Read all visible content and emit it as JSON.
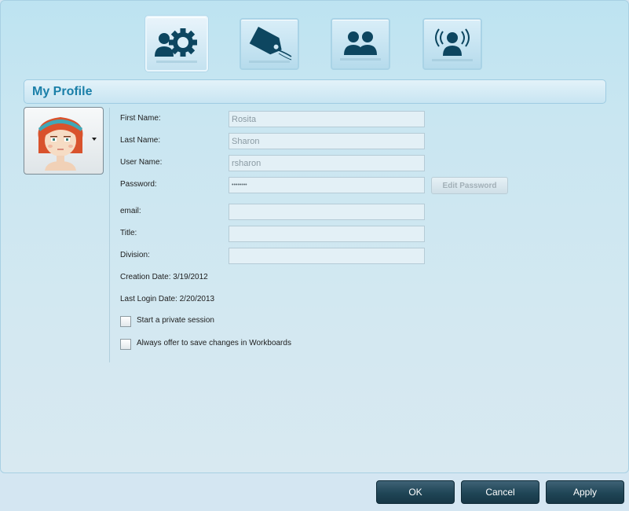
{
  "toolbar": {
    "icons": [
      {
        "name": "settings-user-gear-icon",
        "active": true
      },
      {
        "name": "tags-icon",
        "active": false
      },
      {
        "name": "users-group-icon",
        "active": false
      },
      {
        "name": "broadcast-user-icon",
        "active": false
      }
    ]
  },
  "section": {
    "title": "My Profile"
  },
  "form": {
    "first_name_label": "First Name:",
    "first_name_value": "Rosita",
    "last_name_label": "Last Name:",
    "last_name_value": "Sharon",
    "user_name_label": "User Name:",
    "user_name_value": "rsharon",
    "password_label": "Password:",
    "password_value": "••••••••",
    "edit_password_label": "Edit Password",
    "email_label": "email:",
    "email_value": "",
    "title_label": "Title:",
    "title_value": "",
    "division_label": "Division:",
    "division_value": "",
    "creation_date_text": "Creation Date: 3/19/2012",
    "last_login_text": "Last Login Date: 2/20/2013",
    "private_session_label": "Start a private session",
    "private_session_checked": false,
    "offer_save_label": "Always offer to save changes in Workboards",
    "offer_save_checked": false
  },
  "footer": {
    "ok_label": "OK",
    "cancel_label": "Cancel",
    "apply_label": "Apply"
  },
  "colors": {
    "accent": "#1a7fa8",
    "button_dark": "#1f4556",
    "panel_bg": "#c9e6f1"
  }
}
